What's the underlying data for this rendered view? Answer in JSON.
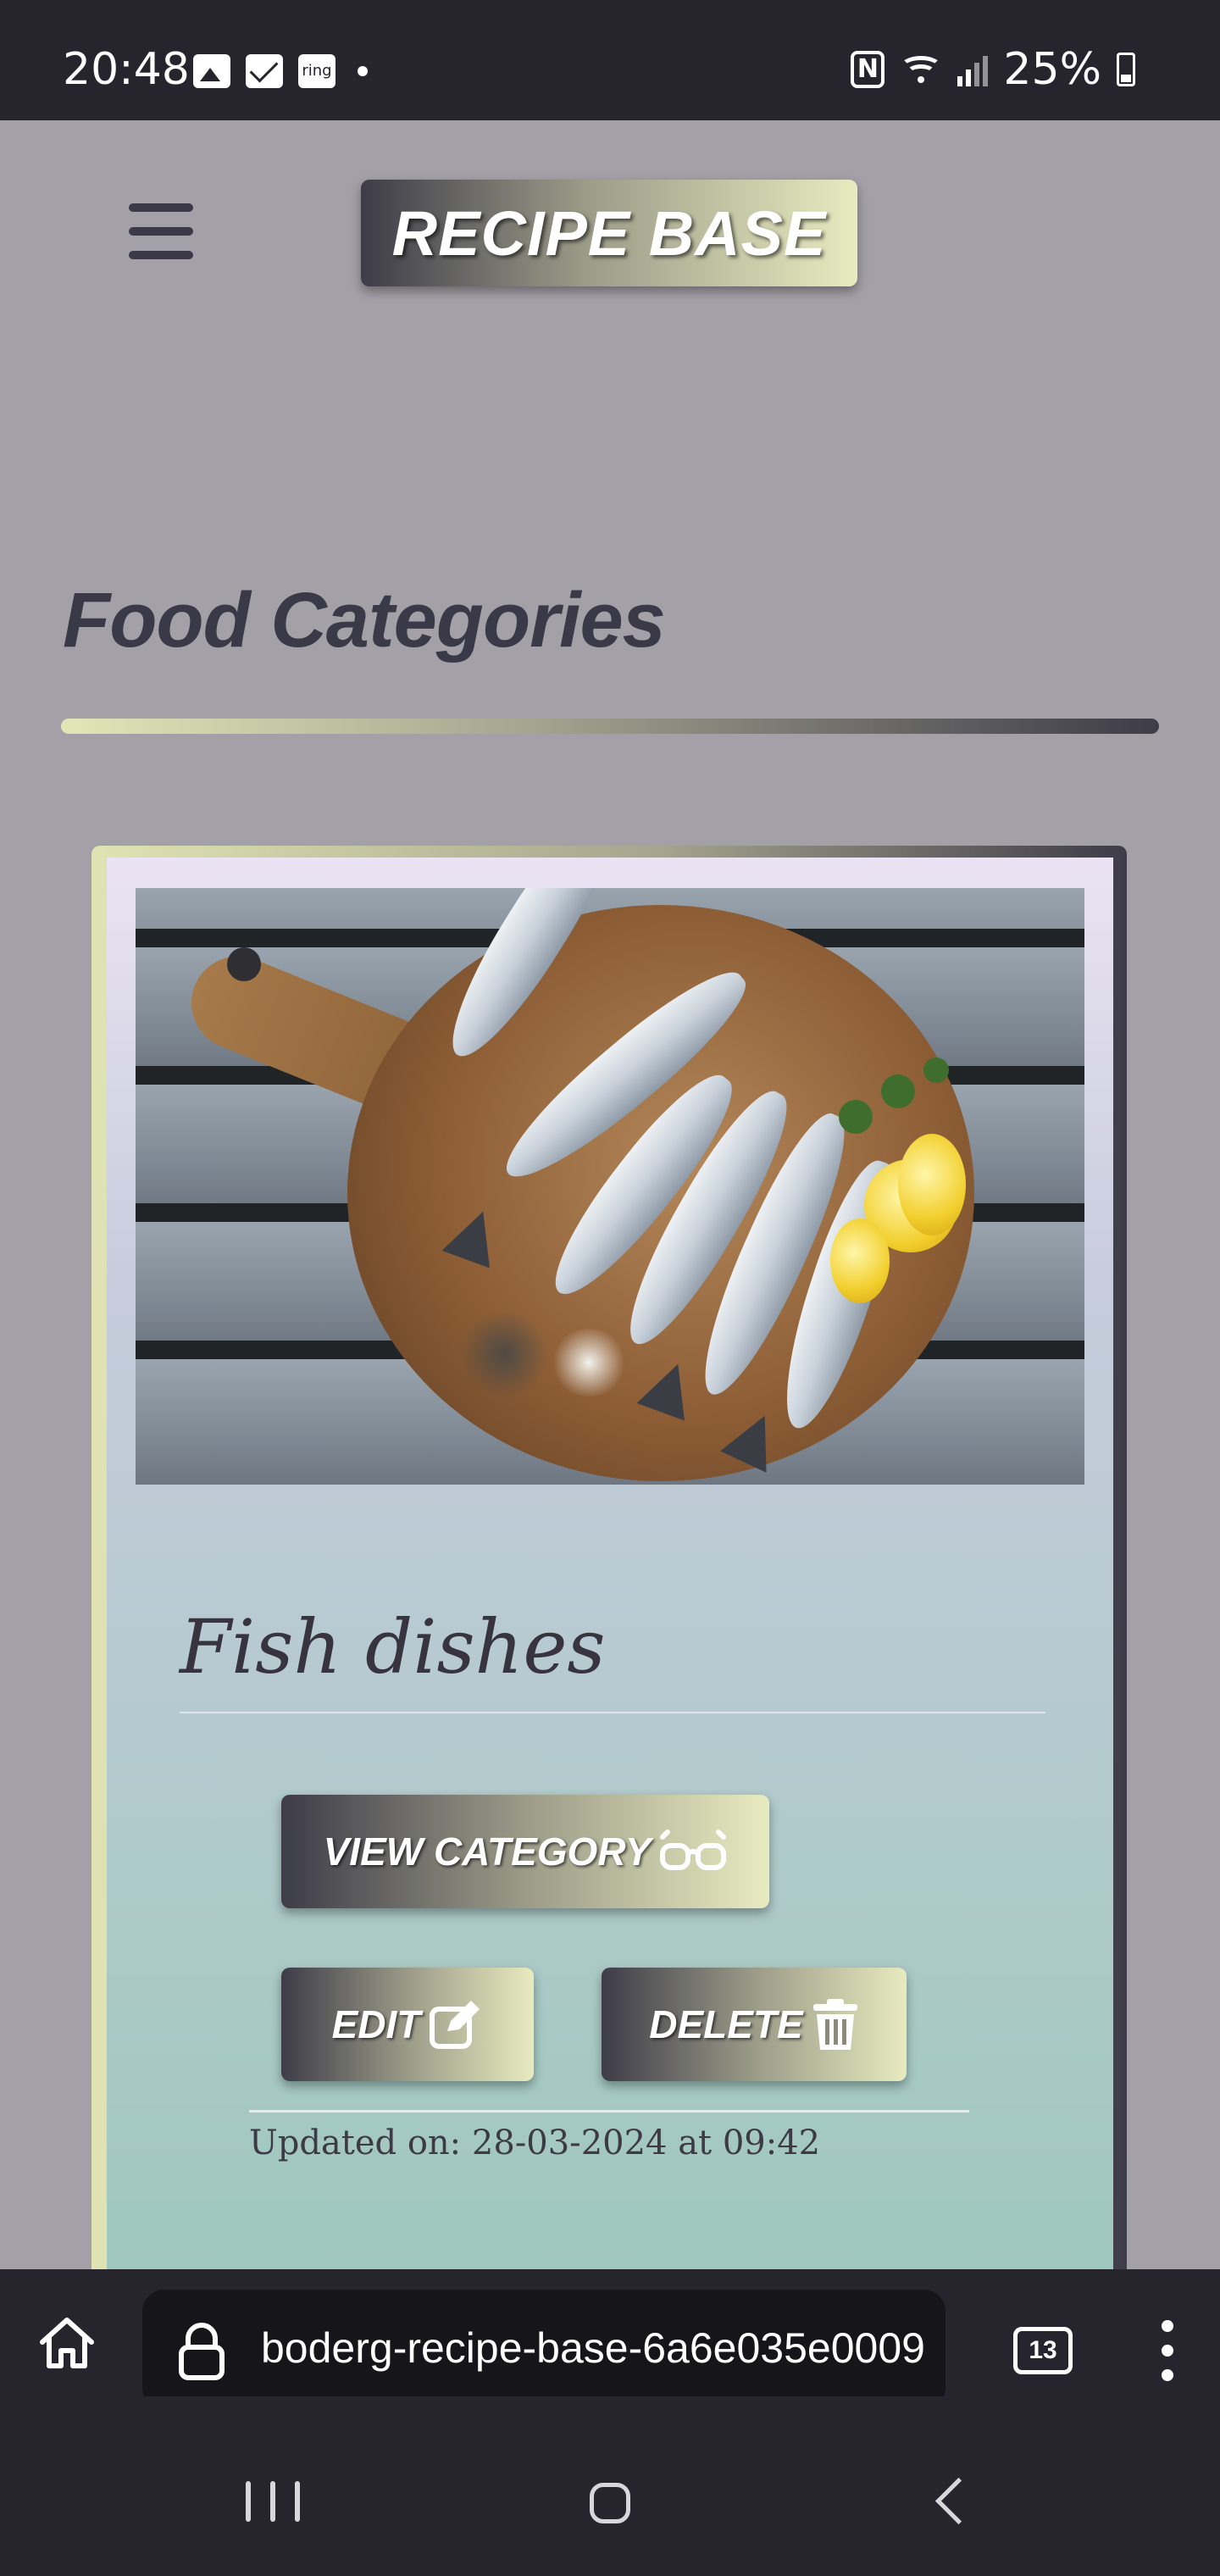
{
  "status_bar": {
    "time": "20:48",
    "notification_ring_label": "ring",
    "battery": "25%",
    "icons": [
      "gallery-icon",
      "mail-icon",
      "ring-icon",
      "nfc-icon",
      "wifi-icon",
      "signal-icon",
      "battery-icon"
    ]
  },
  "header": {
    "brand": "RECIPE BASE"
  },
  "page": {
    "title": "Food Categories"
  },
  "card": {
    "title": "Fish dishes",
    "view_label": "VIEW CATEGORY",
    "edit_label": "EDIT",
    "delete_label": "DELETE",
    "updated": "Updated on: 28-03-2024 at 09:42"
  },
  "browser": {
    "url": "boderg-recipe-base-6a6e035e0009",
    "tab_count": "13"
  },
  "colors": {
    "background": "#a3a1a7",
    "dark": "#3a3947",
    "accent_light": "#e8ebbf"
  }
}
